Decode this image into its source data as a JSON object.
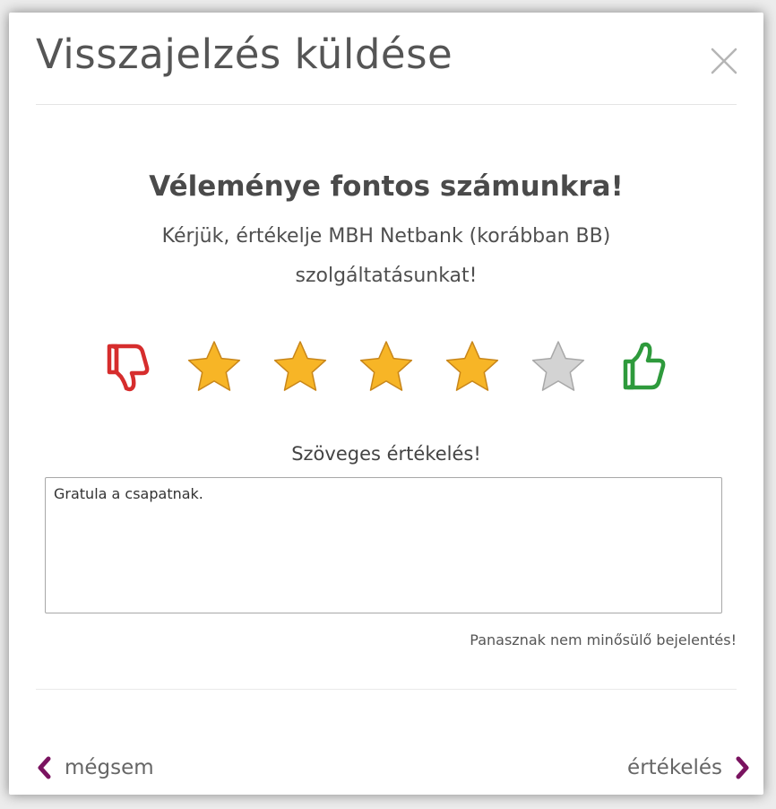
{
  "dialog": {
    "title": "Visszajelzés küldése",
    "close_icon": "close-icon"
  },
  "content": {
    "headline": "Véleménye fontos számunkra!",
    "subtitle": "Kérjük, értékelje MBH Netbank (korábban BB) szolgáltatásunkat!"
  },
  "rating": {
    "value": 4,
    "max": 5,
    "icons": {
      "dislike": "thumbs-down-icon",
      "like": "thumbs-up-icon",
      "star": "star-icon"
    },
    "colors": {
      "dislike": "#d62d2d",
      "like": "#2e9a3c",
      "star_filled": "#f7b526",
      "star_empty": "#d3d3d3"
    }
  },
  "feedback": {
    "label": "Szöveges értékelés!",
    "value": "Gratula a csapatnak.",
    "note": "Panasznak nem minősülő bejelentés!"
  },
  "actions": {
    "cancel_label": "mégsem",
    "submit_label": "értékelés",
    "accent_color": "#7a1360"
  }
}
